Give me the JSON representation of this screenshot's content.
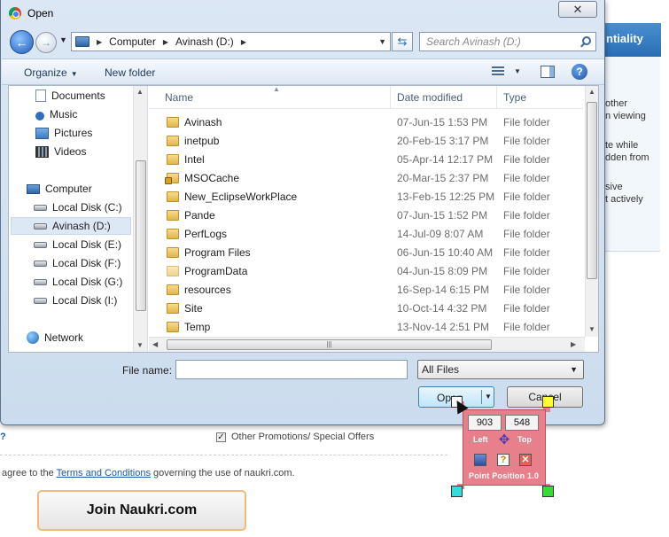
{
  "background_page": {
    "panel_title": "ntiality",
    "snippets": [
      "other",
      "n viewing",
      "te while",
      "dden from",
      "sive",
      "t actively"
    ],
    "promo_label": "Other Promotions/ Special Offers",
    "help_glyph": "?",
    "terms_prefix": "agree to the ",
    "terms_link": "Terms and Conditions",
    "terms_suffix": " governing the use of naukri.com.",
    "join_button": "Join Naukri.com"
  },
  "dialog": {
    "title": "Open",
    "close_glyph": "✕",
    "address": {
      "crumbs": [
        "Computer",
        "Avinash (D:)"
      ]
    },
    "search_placeholder": "Search Avinash (D:)",
    "toolbar": {
      "organize": "Organize",
      "new_folder": "New folder"
    },
    "nav_pane": {
      "items": [
        {
          "label": "Documents",
          "icon": "documents-icon"
        },
        {
          "label": "Music",
          "icon": "music-icon"
        },
        {
          "label": "Pictures",
          "icon": "pictures-icon"
        },
        {
          "label": "Videos",
          "icon": "videos-icon"
        },
        {
          "label": "Computer",
          "icon": "computer-icon"
        },
        {
          "label": "Local Disk (C:)",
          "icon": "disk-icon"
        },
        {
          "label": "Avinash (D:)",
          "icon": "disk-icon",
          "selected": true
        },
        {
          "label": "Local Disk (E:)",
          "icon": "disk-icon"
        },
        {
          "label": "Local Disk (F:)",
          "icon": "disk-icon"
        },
        {
          "label": "Local Disk (G:)",
          "icon": "disk-icon"
        },
        {
          "label": "Local Disk (I:)",
          "icon": "disk-icon"
        },
        {
          "label": "Network",
          "icon": "network-icon"
        }
      ]
    },
    "columns": {
      "name": "Name",
      "date": "Date modified",
      "type": "Type"
    },
    "files": [
      {
        "name": "Avinash",
        "date": "07-Jun-15 1:53 PM",
        "type": "File folder"
      },
      {
        "name": "inetpub",
        "date": "20-Feb-15 3:17 PM",
        "type": "File folder"
      },
      {
        "name": "Intel",
        "date": "05-Apr-14 12:17 PM",
        "type": "File folder"
      },
      {
        "name": "MSOCache",
        "date": "20-Mar-15 2:37 PM",
        "type": "File folder",
        "locked": true
      },
      {
        "name": "New_EclipseWorkPlace",
        "date": "13-Feb-15 12:25 PM",
        "type": "File folder"
      },
      {
        "name": "Pande",
        "date": "07-Jun-15 1:52 PM",
        "type": "File folder"
      },
      {
        "name": "PerfLogs",
        "date": "14-Jul-09 8:07 AM",
        "type": "File folder"
      },
      {
        "name": "Program Files",
        "date": "06-Jun-15 10:40 AM",
        "type": "File folder"
      },
      {
        "name": "ProgramData",
        "date": "04-Jun-15 8:09 PM",
        "type": "File folder",
        "faded": true
      },
      {
        "name": "resources",
        "date": "16-Sep-14 6:15 PM",
        "type": "File folder"
      },
      {
        "name": "Site",
        "date": "10-Oct-14 4:32 PM",
        "type": "File folder"
      },
      {
        "name": "Temp",
        "date": "13-Nov-14 2:51 PM",
        "type": "File folder"
      }
    ],
    "file_name_label": "File name:",
    "file_name_value": "",
    "file_type": "All Files",
    "open_button": "Open",
    "cancel_button": "Cancel"
  },
  "point_position": {
    "x_value": "903",
    "y_value": "548",
    "left_label": "Left",
    "top_label": "Top",
    "tool_name": "Point Position 1.0"
  },
  "colors": {
    "accent": "#2a6db5",
    "tool_bg": "#e8808b",
    "join_border": "#f3b979"
  }
}
